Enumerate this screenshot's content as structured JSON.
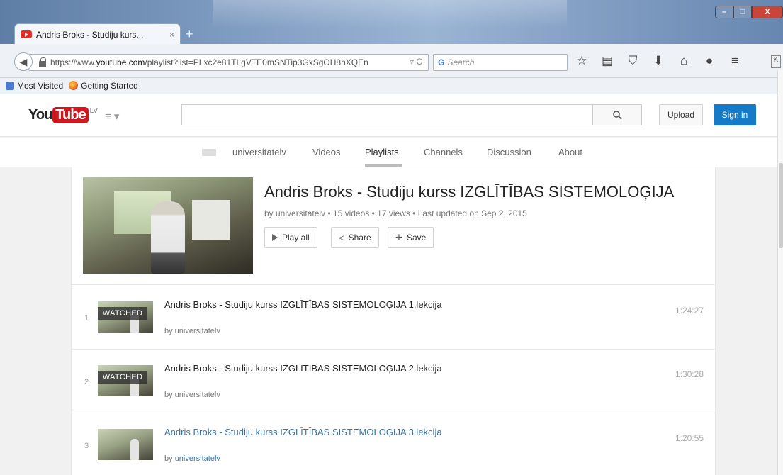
{
  "browser": {
    "tab_title": "Andris Broks - Studiju kurs...",
    "tab_close": "×",
    "new_tab": "+",
    "url_prefix": "https://www.",
    "url_domain": "youtube.com",
    "url_rest": "/playlist?list=PLxc2e81TLgVTE0mSNTip3GxSgOH8hXQEn",
    "url_controls": "▿ C",
    "search_placeholder": "Search",
    "bookmarks": [
      "Most Visited",
      "Getting Started"
    ],
    "side_key": "K"
  },
  "youtube": {
    "logo_you": "You",
    "logo_tube": "Tube",
    "logo_country": "LV",
    "upload_label": "Upload",
    "signin_label": "Sign in",
    "channel_tabs": [
      "universitatelv",
      "Videos",
      "Playlists",
      "Channels",
      "Discussion",
      "About"
    ],
    "active_tab": "Playlists"
  },
  "playlist": {
    "title": "Andris Broks - Studiju kurss IZGLĪTĪBAS SISTEMOLOĢIJA",
    "meta": "by universitatelv • 15 videos • 17 views • Last updated on Sep 2, 2015",
    "play_all": "Play all",
    "share": "Share",
    "save": "Save"
  },
  "videos": [
    {
      "index": "1",
      "title": "Andris Broks - Studiju kurss IZGLĪTĪBAS SISTEMOLOĢIJA 1.lekcija",
      "by": "by universitatelv",
      "duration": "1:24:27",
      "watched": "WATCHED"
    },
    {
      "index": "2",
      "title": "Andris Broks - Studiju kurss IZGLĪTĪBAS SISTEMOLOĢIJA 2.lekcija",
      "by": "by universitatelv",
      "duration": "1:30:28",
      "watched": "WATCHED"
    },
    {
      "index": "3",
      "title": "Andris Broks - Studiju kurss IZGLĪTĪBAS SISTEMOLOĢIJA 3.lekcija",
      "by_prefix": "by ",
      "by_link": "universitatelv",
      "duration": "1:20:55",
      "watched": ""
    }
  ],
  "colors": {
    "accent": "#cc181e",
    "signin": "#167ac6",
    "link": "#3576a6"
  }
}
